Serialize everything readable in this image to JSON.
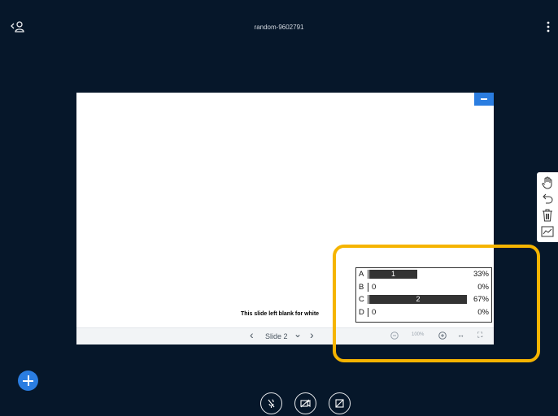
{
  "header": {
    "title": "random-9602791"
  },
  "slide": {
    "body_text": "This slide left blank for white",
    "toolbar": {
      "prev": "‹",
      "slide_label": "Slide 2",
      "dropdown": "⌄",
      "next": "›",
      "zoom_level": "100%",
      "fit_width": "↔",
      "fullscreen": "⛶"
    }
  },
  "poll": {
    "rows": [
      {
        "key": "A",
        "count": "1",
        "percent": "33%",
        "value": 33
      },
      {
        "key": "B",
        "count": "0",
        "percent": "0%",
        "value": 0
      },
      {
        "key": "C",
        "count": "2",
        "percent": "67%",
        "value": 67
      },
      {
        "key": "D",
        "count": "0",
        "percent": "0%",
        "value": 0
      }
    ]
  },
  "colors": {
    "background": "#06172a",
    "accent": "#2a7de1",
    "highlight": "#f5b400"
  }
}
